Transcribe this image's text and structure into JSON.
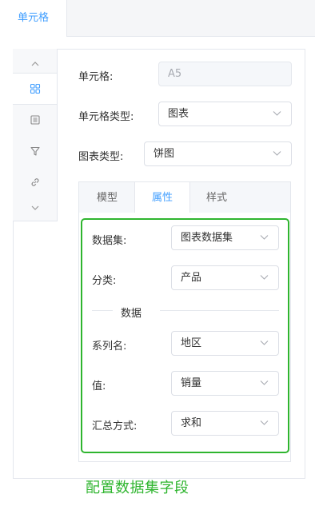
{
  "top_tab": {
    "label": "单元格"
  },
  "rail": {
    "items": [
      {
        "icon": "chevron-up-icon"
      },
      {
        "icon": "grid-icon",
        "active": true
      },
      {
        "icon": "list-icon"
      },
      {
        "icon": "filter-icon"
      },
      {
        "icon": "link-icon"
      },
      {
        "icon": "chevron-down-icon"
      }
    ]
  },
  "form": {
    "cell_label": "单元格:",
    "cell_value": "A5",
    "cell_type_label": "单元格类型:",
    "cell_type_value": "图表",
    "chart_type_label": "图表类型:",
    "chart_type_value": "饼图"
  },
  "subtabs": {
    "model": "模型",
    "attributes": "属性",
    "style": "样式"
  },
  "attributes": {
    "dataset_label": "数据集:",
    "dataset_value": "图表数据集",
    "category_label": "分类:",
    "category_value": "产品",
    "section_title": "数据",
    "series_label": "系列名:",
    "series_value": "地区",
    "value_label": "值:",
    "value_value": "销量",
    "aggregate_label": "汇总方式:",
    "aggregate_value": "求和"
  },
  "annotation": {
    "text": "配置数据集字段",
    "color": "#2fb52f"
  },
  "colors": {
    "accent": "#409eff",
    "highlight": "#2fb52f"
  }
}
